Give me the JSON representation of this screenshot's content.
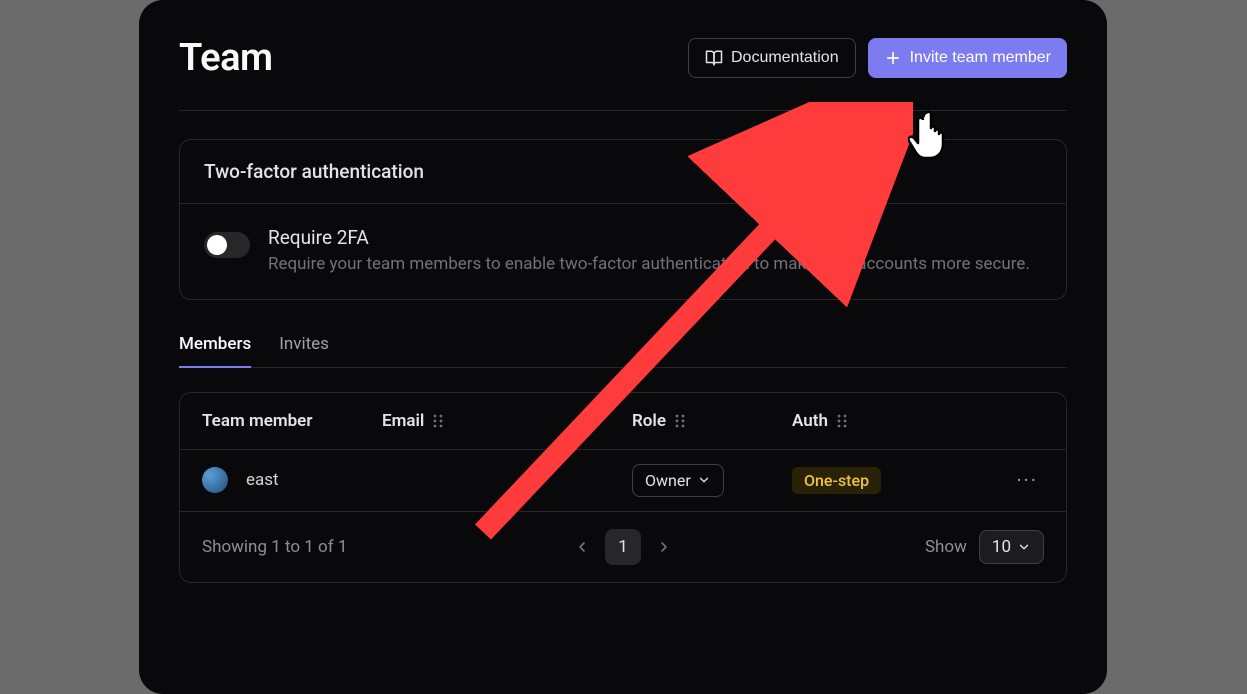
{
  "header": {
    "title": "Team",
    "doc_button": "Documentation",
    "invite_button": "Invite team member"
  },
  "two_fa": {
    "section_title": "Two-factor authentication",
    "toggle_title": "Require 2FA",
    "toggle_desc": "Require your team members to enable two-factor authentication to make their accounts more secure.",
    "enabled": false
  },
  "tabs": {
    "members": "Members",
    "invites": "Invites",
    "active": "members"
  },
  "table": {
    "columns": {
      "team_member": "Team member",
      "email": "Email",
      "role": "Role",
      "auth": "Auth"
    },
    "rows": [
      {
        "name": "east",
        "email": "",
        "role": "Owner",
        "auth": "One-step"
      }
    ]
  },
  "pagination": {
    "summary": "Showing 1 to 1 of 1",
    "page": "1",
    "show_label": "Show",
    "page_size": "10"
  }
}
